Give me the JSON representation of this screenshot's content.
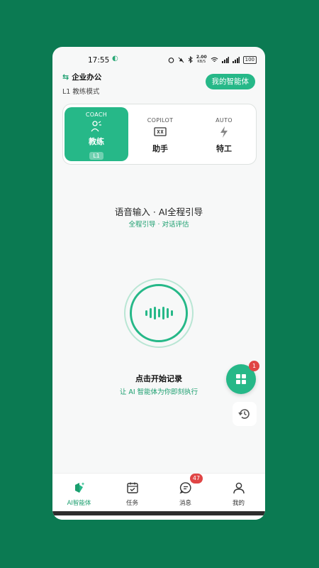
{
  "status_bar": {
    "time": "17:55",
    "net_speed": "2.00",
    "net_unit": "KB/S",
    "battery": "100"
  },
  "header": {
    "org_name": "企业办公",
    "mode_label": "L1 教练模式",
    "my_agent_button": "我的智能体"
  },
  "modes": [
    {
      "tag": "COACH",
      "name": "教练",
      "level": "L1",
      "icon": "coach-person-icon",
      "active": true
    },
    {
      "tag": "COPILOT",
      "name": "助手",
      "icon": "copilot-screen-icon",
      "active": false
    },
    {
      "tag": "AUTO",
      "name": "特工",
      "icon": "lightning-icon",
      "active": false
    }
  ],
  "hint": {
    "title": "语音输入 · AI全程引导",
    "subtitle": "全程引导 · 对话评估"
  },
  "record": {
    "title": "点击开始记录",
    "subtitle": "让 AI 智能体为你即刻执行"
  },
  "fab": {
    "badge": "1",
    "icon": "grid-icon"
  },
  "tabs": [
    {
      "label": "AI智能体",
      "icon": "ai-agent-icon",
      "active": true
    },
    {
      "label": "任务",
      "icon": "task-calendar-icon",
      "active": false
    },
    {
      "label": "消息",
      "icon": "message-icon",
      "active": false,
      "badge": "47"
    },
    {
      "label": "我的",
      "icon": "profile-icon",
      "active": false
    }
  ],
  "colors": {
    "brand": "#26b888",
    "background": "#0b7a52",
    "badge": "#e04545"
  }
}
